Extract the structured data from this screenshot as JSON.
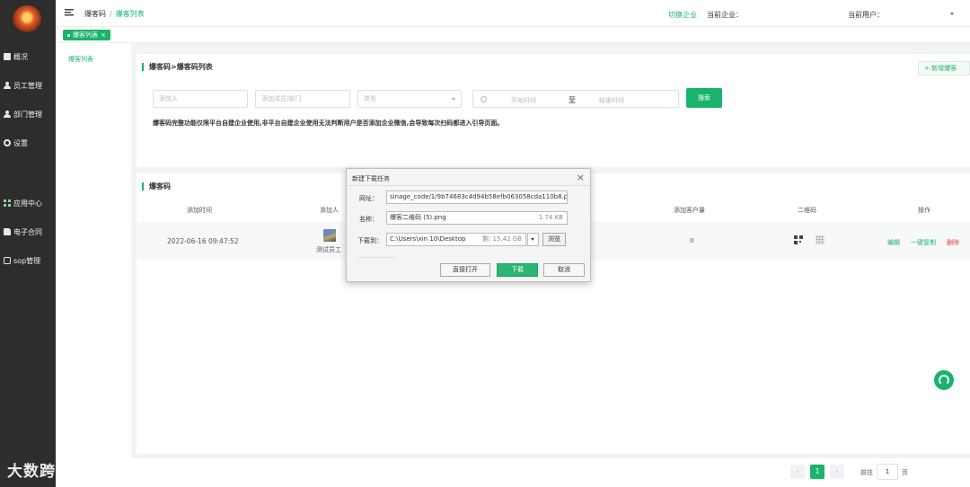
{
  "header": {
    "breadcrumb_root": "爆客码",
    "breadcrumb_sep": "/",
    "breadcrumb_current": "爆客列表",
    "switch_enterprise": "切换企业",
    "current_enterprise_label": "当前企业：",
    "current_user_label": "当前用户："
  },
  "tab": {
    "label": "爆客列表",
    "close": "×"
  },
  "sidebar": {
    "items": [
      {
        "label": "概况",
        "icon": "overview-icon"
      },
      {
        "label": "员工管理",
        "icon": "user-icon"
      },
      {
        "label": "部门管理",
        "icon": "department-icon"
      },
      {
        "label": "设置",
        "icon": "gear-icon"
      },
      {
        "label": "应用中心",
        "icon": "grid-icon"
      },
      {
        "label": "电子合同",
        "icon": "document-icon"
      },
      {
        "label": "sop管理",
        "icon": "sop-icon"
      }
    ]
  },
  "subnav": {
    "item": "爆客列表"
  },
  "filters": {
    "title": "爆客码>爆客码列表",
    "new_button": "+ 新增爆客",
    "adder_placeholder": "添加人",
    "member_placeholder": "添加成员/部门",
    "type_placeholder": "类型",
    "start_placeholder": "开始时间",
    "to_label": "至",
    "end_placeholder": "结束时间",
    "search_button": "搜索",
    "notice": "爆客码完整功能仅限平台自建企业使用,非平台自建企业使用无法判断用户是否添加企业微信,会导致每次扫码都进入引导页面。"
  },
  "table": {
    "title": "爆客码",
    "headers": [
      "添加时间",
      "添加人",
      "添加客户量",
      "二维码",
      "操作"
    ],
    "row": {
      "time": "2022-06-16 09:47:52",
      "adder": "测试员工",
      "customers": "0",
      "ops": [
        "编辑",
        "一键复制",
        "删除"
      ]
    }
  },
  "pager": {
    "prev": "‹",
    "current": "1",
    "next": "›",
    "goto_label": "前往",
    "goto_value": "1",
    "page_unit": "页"
  },
  "dialog": {
    "title": "新建下载任务",
    "close": "×",
    "url_label": "网址：",
    "url_value": "sinage_code/1/9b74683c4d94b58efb063058cda110b8.png",
    "name_label": "名称：",
    "name_value": "爆客二维码 (5).png",
    "name_size": "1.74 KB",
    "path_label": "下载到：",
    "path_value": "C:\\Users\\xin 10\\Desktop",
    "path_free": "剩: 15.42 GB",
    "browse_button": "浏览",
    "open_button": "直接打开",
    "download_button": "下载",
    "cancel_button": "取消"
  },
  "watermark": "大数跨境",
  "colors": {
    "accent": "#19b36b",
    "sidebar": "#2d2d2d",
    "danger": "#e23b3b"
  }
}
